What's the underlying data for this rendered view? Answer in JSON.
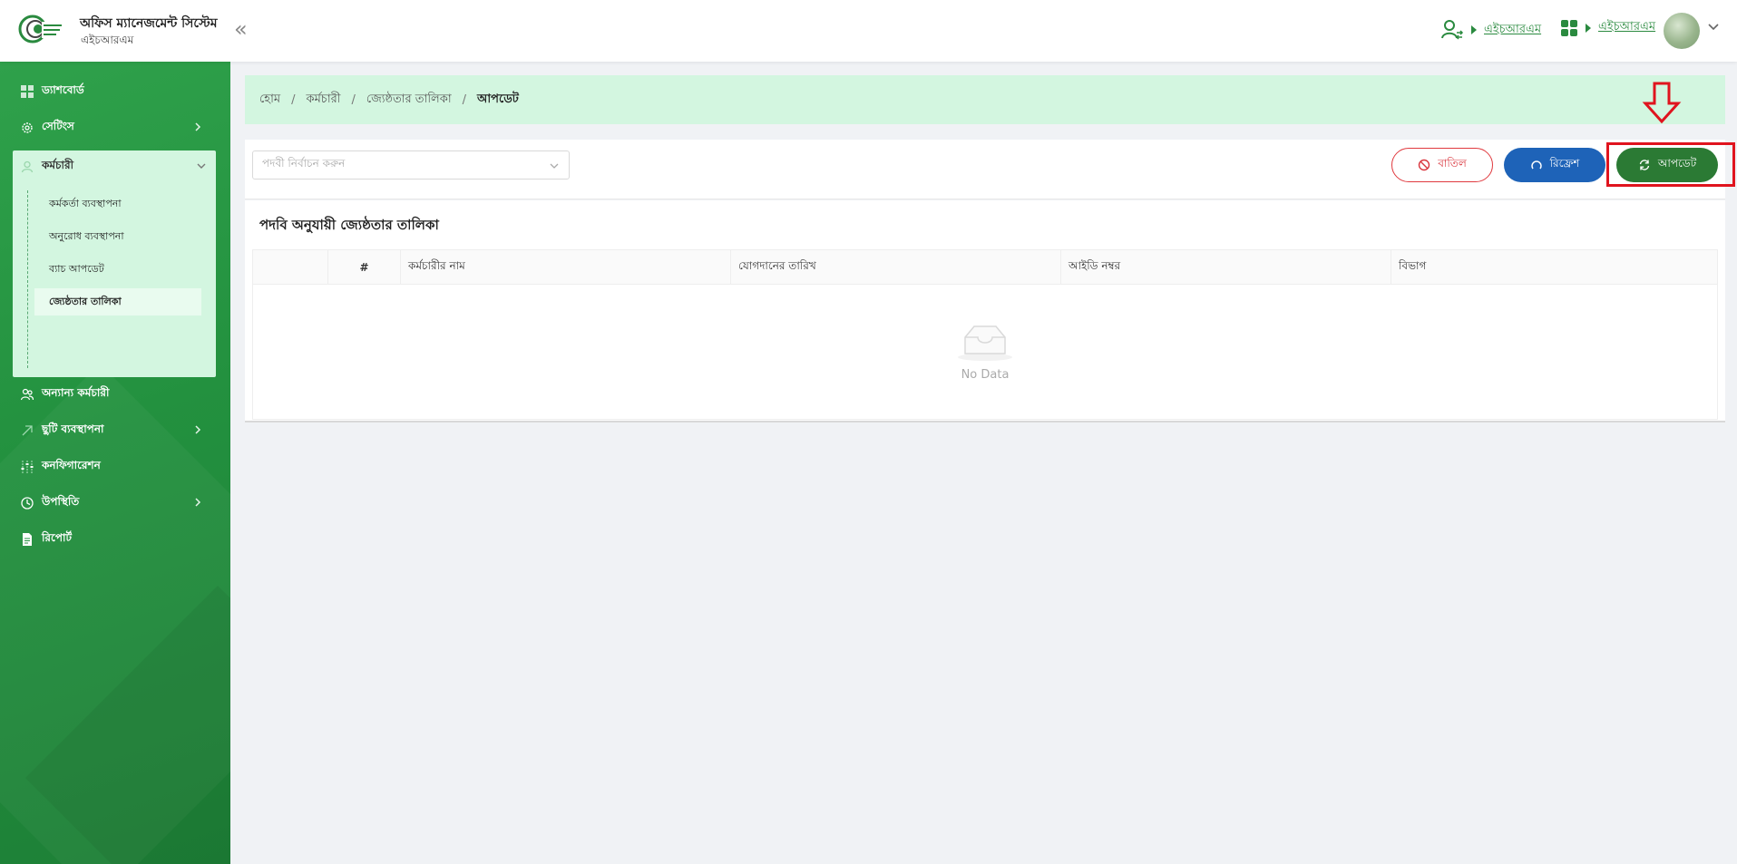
{
  "header": {
    "title": "অফিস ম্যানেজমেন্ট সিস্টেম",
    "subtitle": "এইচআরএম",
    "user_link_1": "এইচআরএম",
    "user_link_2": "এইচআরএম"
  },
  "sidebar": {
    "items": [
      {
        "label": "ড্যাশবোর্ড",
        "icon": "dashboard-icon"
      },
      {
        "label": "সেটিংস",
        "icon": "gear-icon"
      },
      {
        "label": "কর্মচারী",
        "icon": "user-icon"
      },
      {
        "label": "অন্যান্য কর্মচারী",
        "icon": "users-icon"
      },
      {
        "label": "ছুটি ব্যবস্থাপনা",
        "icon": "leave-icon"
      },
      {
        "label": "কনফিগারেশন",
        "icon": "sliders-icon"
      },
      {
        "label": "উপস্থিতি",
        "icon": "clock-icon"
      },
      {
        "label": "রিপোর্ট",
        "icon": "document-icon"
      }
    ],
    "submenu": [
      {
        "label": "কর্মকর্তা ব্যবস্থাপনা"
      },
      {
        "label": "অনুরোধ ব্যবস্থাপনা"
      },
      {
        "label": "ব্যাচ আপডেট"
      },
      {
        "label": "জ্যেষ্ঠতার তালিকা"
      }
    ]
  },
  "breadcrumb": [
    "হোম",
    "কর্মচারী",
    "জ্যেষ্ঠতার তালিকা",
    "আপডেট"
  ],
  "toolbar": {
    "select_placeholder": "পদবী নির্বাচন করুন",
    "cancel_label": "বাতিল",
    "refresh_label": "রিফ্রেশ",
    "update_label": "আপডেট"
  },
  "panel": {
    "title": "পদবি অনুযায়ী জ্যেষ্ঠতার তালিকা",
    "columns": [
      "",
      "#",
      "কর্মচারীর নাম",
      "যোগদানের তারিখ",
      "আইডি নম্বর",
      "বিভাগ"
    ],
    "empty_text": "No Data"
  },
  "colors": {
    "sidebar_green": "#23913f",
    "accent_light": "#d3f6e0",
    "cancel_red": "#d9363e",
    "refresh_blue": "#1e63b8",
    "update_green": "#2b7a34",
    "highlight_red": "#e0141e"
  }
}
